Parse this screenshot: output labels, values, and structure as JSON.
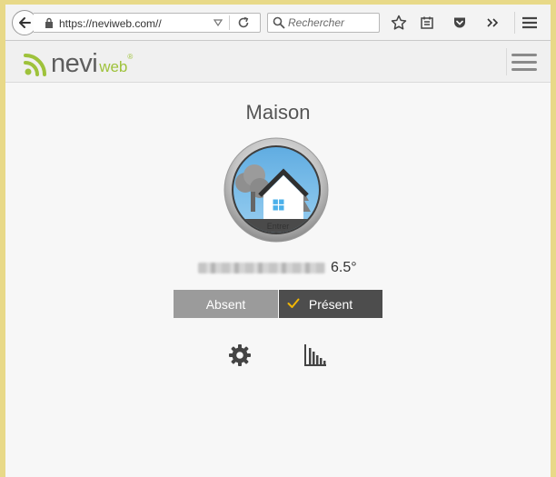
{
  "browser": {
    "url": "https://neviweb.com//",
    "search_placeholder": "Rechercher"
  },
  "site": {
    "logo_main": "nevi",
    "logo_sub": "web",
    "logo_mark": "®"
  },
  "location": {
    "title": "Maison",
    "image_label": "Entrer",
    "temperature": "6.5°"
  },
  "mode": {
    "absent_label": "Absent",
    "present_label": "Présent",
    "selected": "present"
  },
  "icons": [
    "back-arrow-icon",
    "lock-icon",
    "dropdown-icon",
    "reload-icon",
    "search-icon",
    "star-icon",
    "reading-list-icon",
    "pocket-icon",
    "overflow-icon",
    "hamburger-menu-icon",
    "wifi-logo-icon",
    "check-icon",
    "gear-icon",
    "bar-chart-icon"
  ],
  "colors": {
    "accent_green": "#9ec23b",
    "mode_selected": "#4d4d4d",
    "mode_unselected": "#9b9b9b",
    "check": "#f2b705"
  }
}
